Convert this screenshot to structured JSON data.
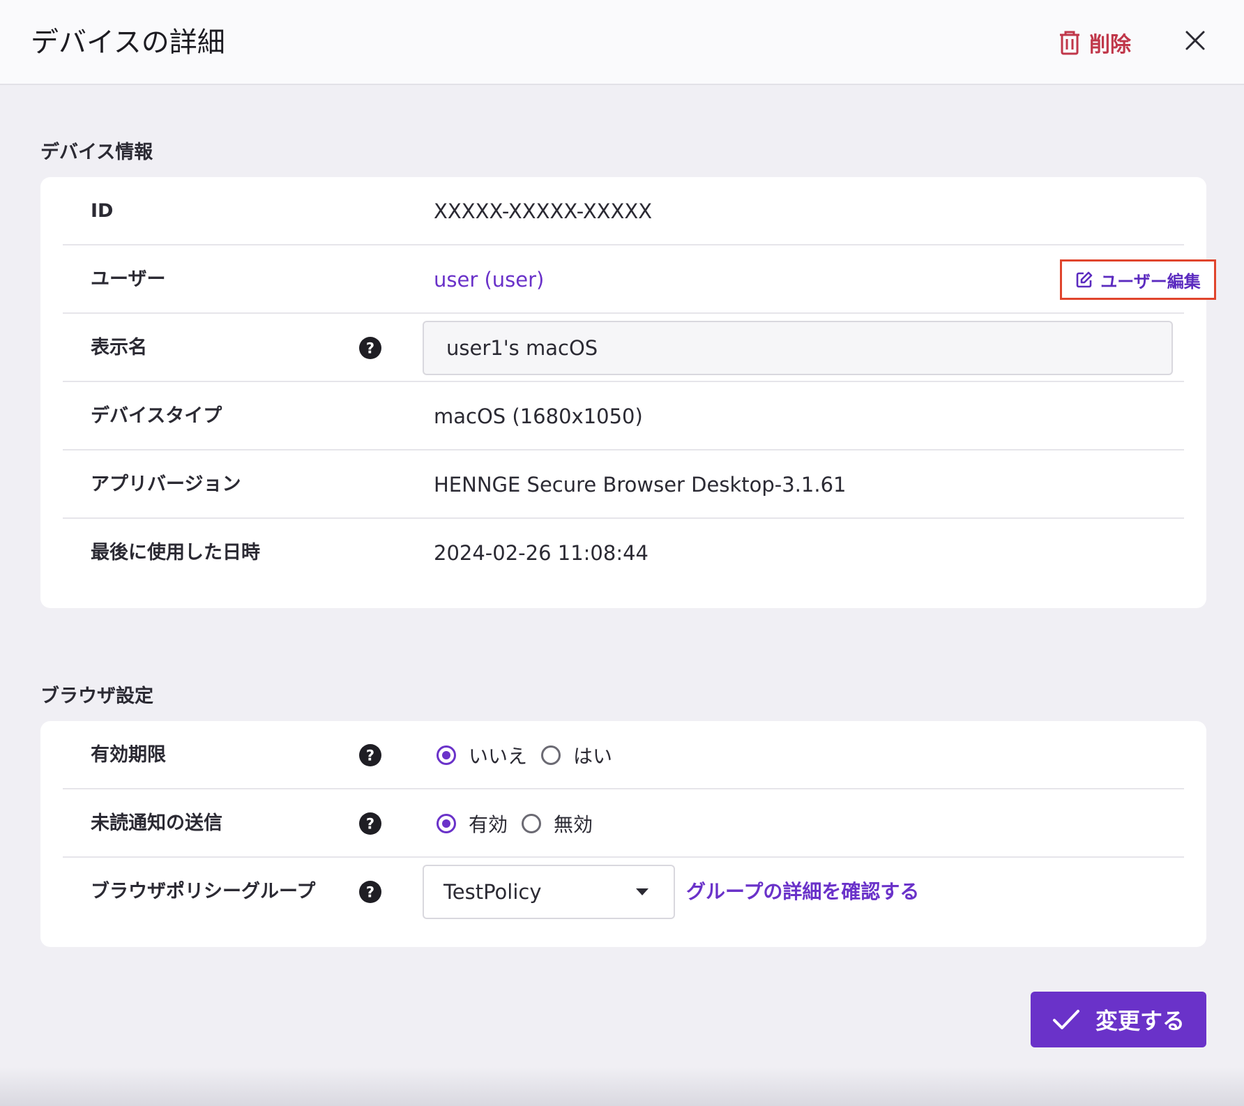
{
  "header": {
    "title": "デバイスの詳細",
    "delete_label": "削除",
    "delete_color": "#c0374a"
  },
  "device_info": {
    "section_title": "デバイス情報",
    "id_label": "ID",
    "id_value": "XXXXX-XXXXX-XXXXX",
    "user_label": "ユーザー",
    "user_value": "user (user)",
    "edit_user_label": "ユーザー編集",
    "display_name_label": "表示名",
    "display_name_value": "user1's macOS",
    "device_type_label": "デバイスタイプ",
    "device_type_value": "macOS (1680x1050)",
    "app_version_label": "アプリバージョン",
    "app_version_value": "HENNGE Secure Browser Desktop-3.1.61",
    "last_used_label": "最後に使用した日時",
    "last_used_value": "2024-02-26 11:08:44"
  },
  "browser_settings": {
    "section_title": "ブラウザ設定",
    "expiry_label": "有効期限",
    "expiry_options": [
      {
        "label": "いいえ",
        "checked": true
      },
      {
        "label": "はい",
        "checked": false
      }
    ],
    "unread_label": "未読通知の送信",
    "unread_options": [
      {
        "label": "有効",
        "checked": true
      },
      {
        "label": "無効",
        "checked": false
      }
    ],
    "policy_group_label": "ブラウザポリシーグループ",
    "policy_group_value": "TestPolicy",
    "group_detail_link": "グループの詳細を確認する"
  },
  "footer": {
    "submit_label": "変更する",
    "accent_color": "#6a32c9"
  }
}
